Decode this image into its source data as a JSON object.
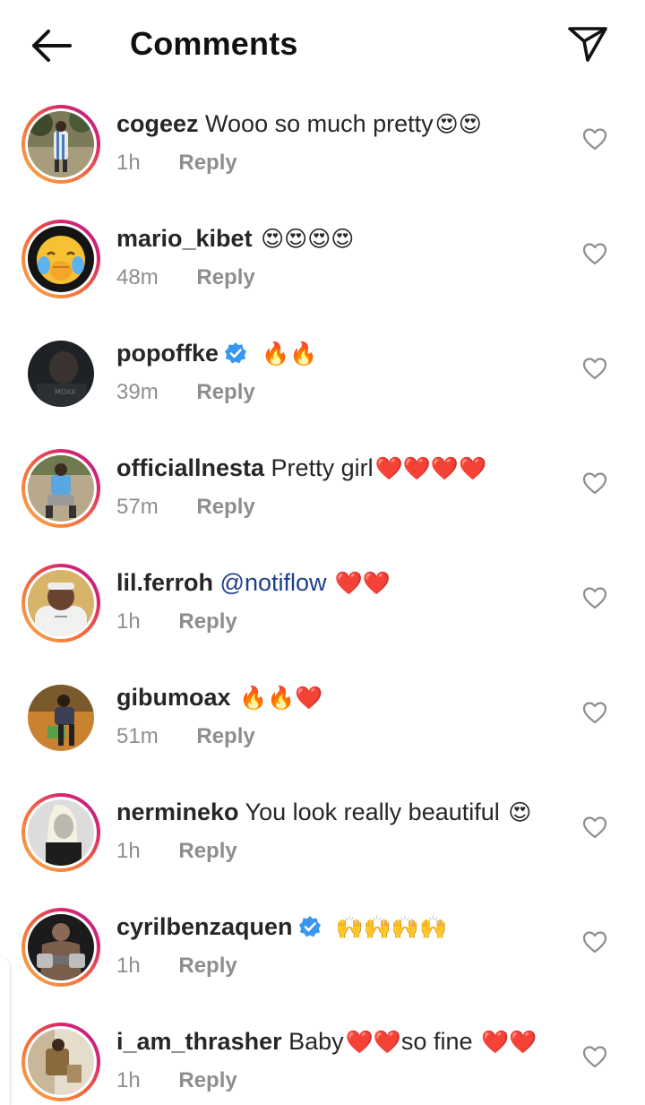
{
  "header": {
    "title": "Comments",
    "back_icon": "arrow-left-icon",
    "share_icon": "paper-plane-icon"
  },
  "colors": {
    "story_gradient": [
      "#f7b24a",
      "#f56a3c",
      "#d8246e",
      "#b0259a"
    ],
    "verified_blue": "#3897f0",
    "mention": "#1d3f8c",
    "meta_grey": "#8e8e8e"
  },
  "comments": [
    {
      "username": "cogeez",
      "text": " Wooo so much pretty",
      "emoji": "😍😍",
      "time": "1h",
      "reply": "Reply",
      "verified": false,
      "story": true
    },
    {
      "username": "mario_kibet",
      "text": " ",
      "emoji": "😍😍😍😍",
      "time": "48m",
      "reply": "Reply",
      "verified": false,
      "story": true
    },
    {
      "username": "popoffke",
      "text": "",
      "emoji": "🔥🔥",
      "time": "39m",
      "reply": "Reply",
      "verified": true,
      "story": false
    },
    {
      "username": "officiallnesta",
      "text": " Pretty girl",
      "emoji": "❤️❤️❤️❤️",
      "time": "57m",
      "reply": "Reply",
      "verified": false,
      "story": true
    },
    {
      "username": "lil.ferroh",
      "text": " ",
      "mention": "@notiflow",
      "emoji": " ❤️❤️",
      "time": "1h",
      "reply": "Reply",
      "verified": false,
      "story": true
    },
    {
      "username": "gibumoax",
      "text": " ",
      "emoji": "🔥🔥❤️",
      "time": "51m",
      "reply": "Reply",
      "verified": false,
      "story": false
    },
    {
      "username": "nermineko",
      "text": " You look really beautiful ",
      "emoji": "😍",
      "time": "1h",
      "reply": "Reply",
      "verified": false,
      "story": true
    },
    {
      "username": "cyrilbenzaquen",
      "text": "",
      "emoji": "🙌🙌🙌🙌",
      "time": "1h",
      "reply": "Reply",
      "verified": true,
      "story": true
    },
    {
      "username": "i_am_thrasher",
      "text": " Baby",
      "emoji": "❤️❤️",
      "text2": "so fine ",
      "emoji2": "❤️❤️",
      "time": "1h",
      "reply": "Reply",
      "verified": false,
      "story": true
    }
  ]
}
